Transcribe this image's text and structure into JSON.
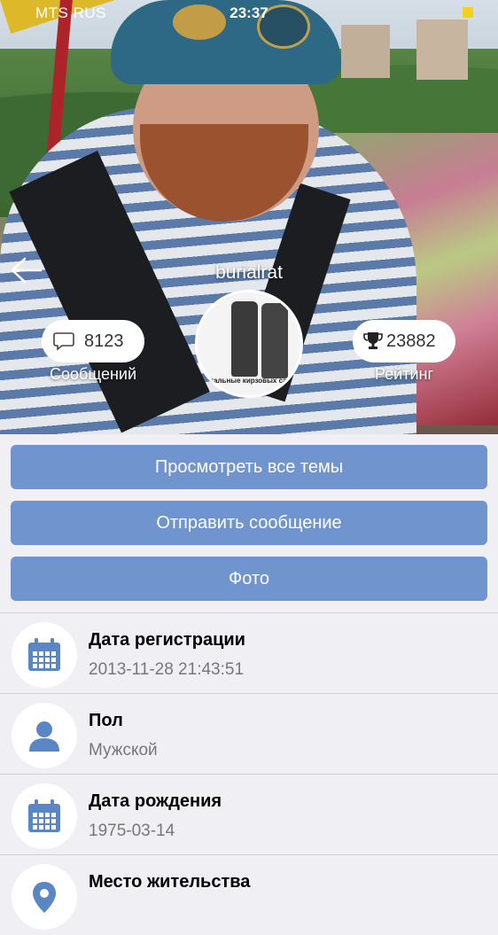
{
  "status_bar": {
    "carrier": "MTS RUS",
    "time": "23:37",
    "battery_color": "#f3d21b"
  },
  "profile": {
    "username": "burialrat",
    "avatar_caption": "Стальные кирзовых сапог",
    "messages_count": "8123",
    "messages_label": "Сообщений",
    "rating_count": "23882",
    "rating_label": "Рейтинг"
  },
  "actions": {
    "view_topics": "Просмотреть все темы",
    "send_message": "Отправить сообщение",
    "photo": "Фото"
  },
  "info": {
    "registration": {
      "title": "Дата регистрации",
      "value": "2013-11-28 21:43:51",
      "icon": "calendar-icon"
    },
    "gender": {
      "title": "Пол",
      "value": "Мужской",
      "icon": "person-icon"
    },
    "birthdate": {
      "title": "Дата рождения",
      "value": "1975-03-14",
      "icon": "calendar-icon"
    },
    "location": {
      "title": "Место жительства",
      "value": "",
      "icon": "location-icon"
    }
  },
  "colors": {
    "accent": "#7094ce",
    "background": "#efeff4"
  }
}
